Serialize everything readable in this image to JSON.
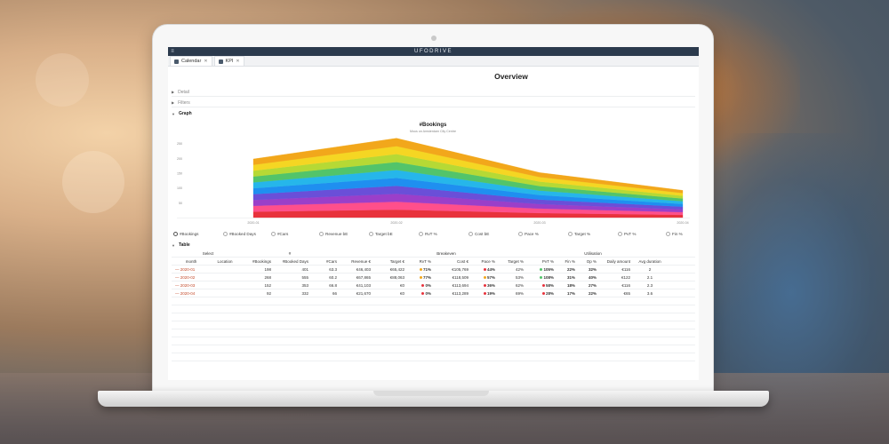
{
  "app": {
    "brand": "UFODRIVE",
    "menu_glyph": "≡"
  },
  "tabs": [
    {
      "label": "Calendar",
      "close": "✕"
    },
    {
      "label": "KPI",
      "close": "✕"
    }
  ],
  "overview_title": "Overview",
  "sections": {
    "detail": "Detail",
    "filters": "Filters",
    "graph": "Graph",
    "table": "Table"
  },
  "chart_data": {
    "type": "area",
    "title": "#Bookings",
    "subtitle": "Mous on Amsterdam City Centre",
    "x": [
      "2020-01",
      "2020-02",
      "2020-03",
      "2020-04"
    ],
    "y_ticks": [
      50,
      100,
      150,
      200,
      250
    ],
    "ylim": [
      0,
      270
    ],
    "stack_totals": [
      198,
      268,
      152,
      92
    ],
    "band_colors": [
      "#e8323c",
      "#ff4f8b",
      "#9b3fc9",
      "#6a4fd8",
      "#1f8ff0",
      "#26b6ea",
      "#52c46a",
      "#b6d935",
      "#f5d623",
      "#f2a71b"
    ],
    "grid": false,
    "legend_position": "bottom"
  },
  "legend": [
    "#Bookings",
    "#Booked Days",
    "#Cars",
    "Revenue bE",
    "Target bE",
    "RvT %",
    "Cost bE",
    "Pace %",
    "Target %",
    "PvT %",
    "Fin %"
  ],
  "legend_selected": "#Bookings",
  "table": {
    "group_headers": [
      "Select",
      "#",
      "Breakeven",
      "Utilisation"
    ],
    "headers": [
      "month",
      "Location",
      "#Bookings",
      "#Booked Days",
      "#Cars",
      "Revenue €",
      "Target €",
      "RvT %",
      "Cost €",
      "Pace %",
      "Target %",
      "PvT %",
      "Fin %",
      "Op %",
      "Daily amount",
      "Avg duration"
    ],
    "rows": [
      {
        "month": "2020-01",
        "location": "",
        "bookings": "198",
        "booked_days": "401",
        "cars": "63.3",
        "revenue": "€46,403",
        "target": "€65,422",
        "rvt": "71%",
        "rvt_color": "#f2a71b",
        "cost": "€105,769",
        "pace": "44%",
        "pace_color": "#e8323c",
        "target_pct": "42%",
        "pvt": "105%",
        "pvt_color": "#52c46a",
        "fin": "22%",
        "op": "32%",
        "daily": "€116",
        "avg": "2"
      },
      {
        "month": "2020-02",
        "location": "",
        "bookings": "268",
        "booked_days": "555",
        "cars": "60.2",
        "revenue": "€67,865",
        "target": "€88,063",
        "rvt": "77%",
        "rvt_color": "#f2a71b",
        "cost": "€118,509",
        "pace": "57%",
        "pace_color": "#f2a71b",
        "target_pct": "53%",
        "pvt": "108%",
        "pvt_color": "#52c46a",
        "fin": "31%",
        "op": "40%",
        "daily": "€122",
        "avg": "2.1"
      },
      {
        "month": "2020-03",
        "location": "",
        "bookings": "152",
        "booked_days": "353",
        "cars": "66.8",
        "revenue": "€41,103",
        "target": "€0",
        "rvt": "0%",
        "rvt_color": "#e8323c",
        "cost": "€113,694",
        "pace": "36%",
        "pace_color": "#e8323c",
        "target_pct": "62%",
        "pvt": "58%",
        "pvt_color": "#e8323c",
        "fin": "18%",
        "op": "27%",
        "daily": "€116",
        "avg": "2.3"
      },
      {
        "month": "2020-04",
        "location": "",
        "bookings": "92",
        "booked_days": "332",
        "cars": "66",
        "revenue": "€21,670",
        "target": "€0",
        "rvt": "0%",
        "rvt_color": "#e8323c",
        "cost": "€113,289",
        "pace": "19%",
        "pace_color": "#e8323c",
        "target_pct": "69%",
        "pvt": "28%",
        "pvt_color": "#e8323c",
        "fin": "17%",
        "op": "22%",
        "daily": "€65",
        "avg": "3.6"
      }
    ]
  }
}
